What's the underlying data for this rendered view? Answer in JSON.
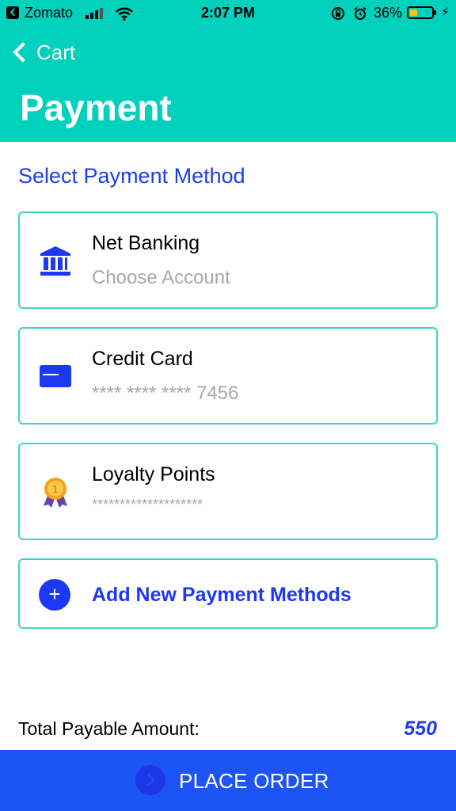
{
  "status_bar": {
    "carrier": "Zomato",
    "time": "2:07 PM",
    "battery_percent": "36%",
    "battery_level": 0.36,
    "battery_color": "#F5C400"
  },
  "header": {
    "back_label": "Cart",
    "title": "Payment",
    "background_color": "#00D1BC"
  },
  "section_title": "Select Payment Method",
  "payment_methods": [
    {
      "title": "Net Banking",
      "subtitle": "Choose Account",
      "icon": "bank-icon"
    },
    {
      "title": "Credit Card",
      "subtitle": "**** **** **** 7456",
      "icon": "credit-card-icon"
    },
    {
      "title": "Loyalty Points",
      "subtitle": "********************",
      "icon": "medal-icon"
    }
  ],
  "add_method": {
    "label": "Add New Payment Methods",
    "icon": "plus-circle-icon"
  },
  "total": {
    "label": "Total Payable Amount:",
    "value": "550"
  },
  "place_order": {
    "label": "PLACE ORDER",
    "icon": "chevron-right-circle-icon",
    "color": "#1D54F5"
  },
  "accent_color": "#1D38F2"
}
